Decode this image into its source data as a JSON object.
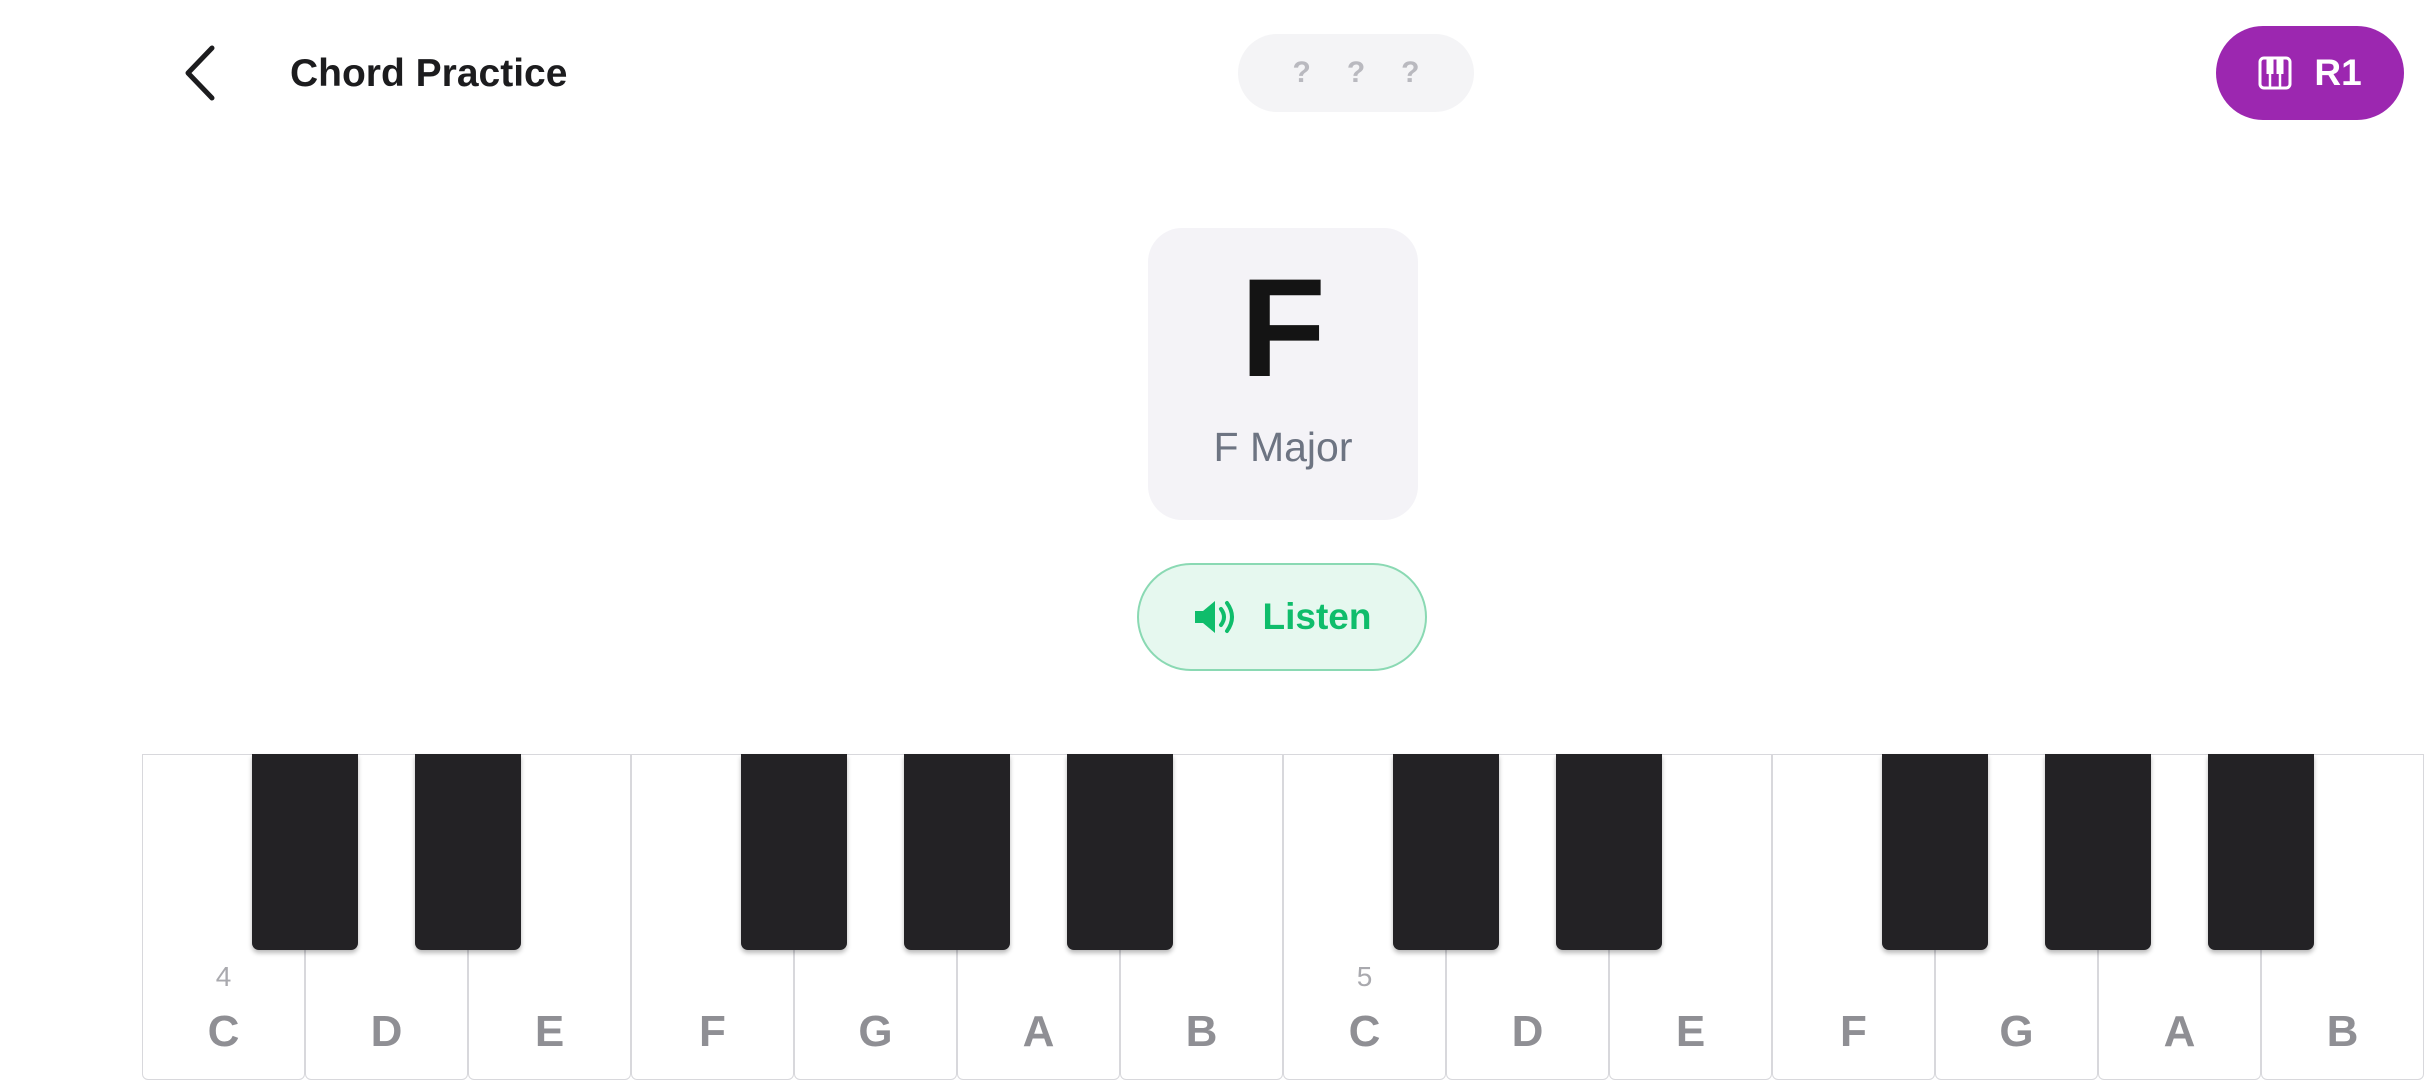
{
  "header": {
    "title": "Chord Practice",
    "progress_slots": [
      "?",
      "?",
      "?"
    ],
    "device_label": "R1"
  },
  "chord": {
    "symbol": "F",
    "name": "F Major"
  },
  "listen": {
    "label": "Listen"
  },
  "colors": {
    "accent_purple": "#9c27b0",
    "listen_green": "#0fbd6b",
    "listen_bg": "#e6f8ef",
    "black_key": "#232225"
  },
  "piano": {
    "white_keys": [
      {
        "note": "C",
        "octave": "4"
      },
      {
        "note": "D"
      },
      {
        "note": "E"
      },
      {
        "note": "F"
      },
      {
        "note": "G"
      },
      {
        "note": "A"
      },
      {
        "note": "B"
      },
      {
        "note": "C",
        "octave": "5"
      },
      {
        "note": "D"
      },
      {
        "note": "E"
      },
      {
        "note": "F"
      },
      {
        "note": "G"
      },
      {
        "note": "A"
      },
      {
        "note": "B"
      }
    ],
    "black_keys": [
      "C#",
      "D#",
      "F#",
      "G#",
      "A#",
      "C#",
      "D#",
      "F#",
      "G#",
      "A#"
    ]
  }
}
